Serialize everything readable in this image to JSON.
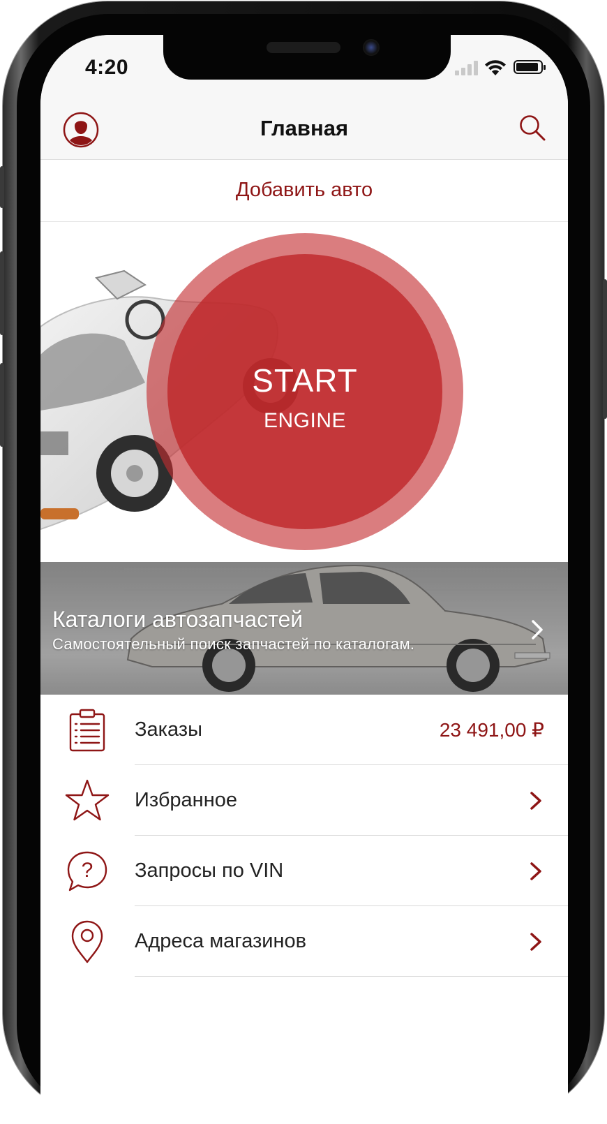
{
  "status_bar": {
    "time": "4:20"
  },
  "nav": {
    "title": "Главная"
  },
  "add_car": {
    "label": "Добавить авто"
  },
  "start_button": {
    "line1": "START",
    "line2": "ENGINE"
  },
  "catalog": {
    "title": "Каталоги автозапчастей",
    "subtitle": "Самостоятельный поиск запчастей по каталогам."
  },
  "menu": {
    "items": [
      {
        "label": "Заказы",
        "value": "23 491,00 ₽",
        "icon": "clipboard-list-icon"
      },
      {
        "label": "Избранное",
        "icon": "star-icon"
      },
      {
        "label": "Запросы по VIN",
        "icon": "question-bubble-icon"
      },
      {
        "label": "Адреса магазинов",
        "icon": "location-pin-icon"
      }
    ]
  },
  "colors": {
    "accent": "#8e1515",
    "start_red": "#c0282c",
    "nav_bg": "#f7f7f7"
  }
}
